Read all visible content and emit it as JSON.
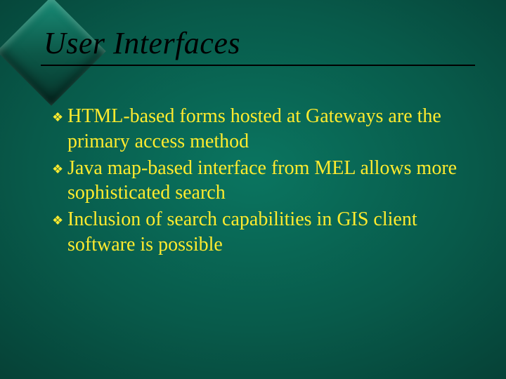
{
  "title": "User Interfaces",
  "bullets": {
    "b0": "HTML-based forms hosted at Gateways are the primary access method",
    "b1": "Java map-based interface from MEL allows more sophisticated search",
    "b2": "Inclusion of search capabilities in GIS client software is possible"
  }
}
